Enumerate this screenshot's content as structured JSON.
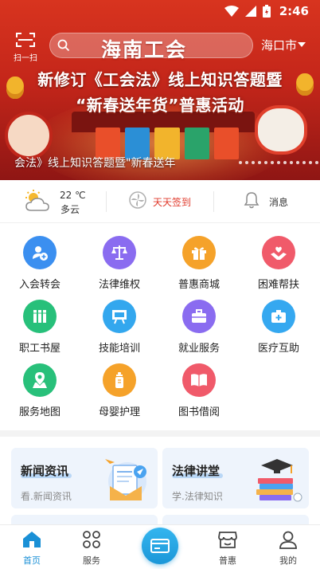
{
  "status_bar": {
    "time": "2:46"
  },
  "topbar": {
    "scan_label": "扫一扫",
    "search_placeholder": "",
    "brand_text": "海南工会",
    "city": "海口市"
  },
  "banner": {
    "headline_line1": "新修订《工会法》线上知识答题暨",
    "headline_line2": "“新春送年货”普惠活动",
    "caption": "会法》线上知识答题暨\"新春送年",
    "colors": {
      "base": "#c4261a",
      "text": "#ffffff"
    }
  },
  "info_row": {
    "temperature": "22 ℃",
    "condition": "多云",
    "checkin_label": "天天签到",
    "messages_label": "消息",
    "weather_icon": "partly-cloudy-icon",
    "checkin_icon": "fan-icon",
    "messages_icon": "bell-icon"
  },
  "services": [
    {
      "label": "入会转会",
      "icon": "member-add-icon",
      "color": "#3b8ff0"
    },
    {
      "label": "法律维权",
      "icon": "scales-icon",
      "color": "#8a6cf0"
    },
    {
      "label": "普惠商城",
      "icon": "gift-icon",
      "color": "#f5a22a"
    },
    {
      "label": "困难帮扶",
      "icon": "helping-hands-icon",
      "color": "#f05a6a"
    },
    {
      "label": "职工书屋",
      "icon": "books-icon",
      "color": "#27c07a"
    },
    {
      "label": "技能培训",
      "icon": "presentation-icon",
      "color": "#33a7ee"
    },
    {
      "label": "就业服务",
      "icon": "briefcase-icon",
      "color": "#8a6cf0"
    },
    {
      "label": "医疗互助",
      "icon": "medical-kit-icon",
      "color": "#35a8f0"
    },
    {
      "label": "服务地图",
      "icon": "map-pin-icon",
      "color": "#28c07a"
    },
    {
      "label": "母婴护理",
      "icon": "baby-bottle-icon",
      "color": "#f5a22a"
    },
    {
      "label": "图书借阅",
      "icon": "open-book-icon",
      "color": "#f05a6a"
    }
  ],
  "cards": [
    {
      "title": "新闻资讯",
      "subtitle": "看.新闻资讯"
    },
    {
      "title": "法律讲堂",
      "subtitle": "学.法律知识"
    }
  ],
  "bottom_nav": {
    "items": [
      {
        "label": "首页",
        "icon": "home-icon",
        "active": true
      },
      {
        "label": "服务",
        "icon": "grid-icon",
        "active": false
      },
      {
        "label": "",
        "icon": "card-icon",
        "active": false
      },
      {
        "label": "普惠",
        "icon": "shop-icon",
        "active": false
      },
      {
        "label": "我的",
        "icon": "user-icon",
        "active": false
      }
    ],
    "active_color": "#1a90d6"
  }
}
